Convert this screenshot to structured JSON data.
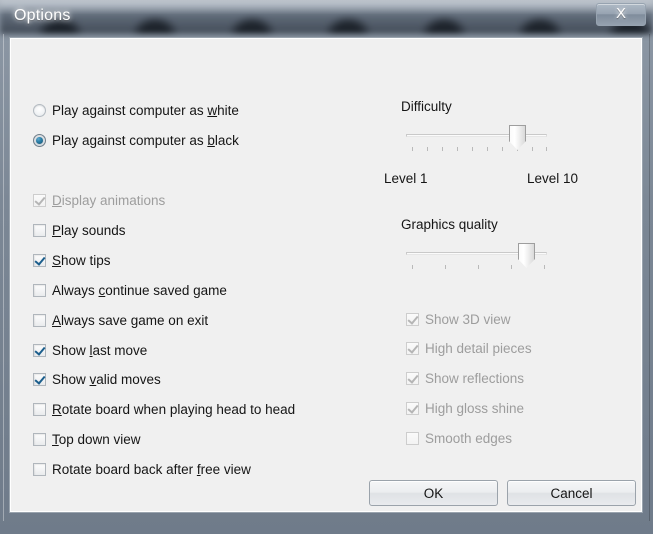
{
  "window": {
    "title": "Options",
    "close_label": "X"
  },
  "play_as": {
    "options": [
      {
        "label_pre": "Play against computer as ",
        "accel": "w",
        "label_post": "hite",
        "checked": false
      },
      {
        "label_pre": "Play against computer as ",
        "accel": "b",
        "label_post": "lack",
        "checked": true
      }
    ]
  },
  "left_checkboxes": [
    {
      "label_pre": "",
      "accel": "D",
      "label_post": "isplay animations",
      "checked": true,
      "disabled": true
    },
    {
      "label_pre": "",
      "accel": "P",
      "label_post": "lay sounds",
      "checked": false,
      "disabled": false
    },
    {
      "label_pre": "",
      "accel": "S",
      "label_post": "how tips",
      "checked": true,
      "disabled": false
    },
    {
      "label_pre": "Always ",
      "accel": "c",
      "label_post": "ontinue saved game",
      "checked": false,
      "disabled": false
    },
    {
      "label_pre": "",
      "accel": "A",
      "label_post": "lways save game on exit",
      "checked": false,
      "disabled": false
    },
    {
      "label_pre": "Show ",
      "accel": "l",
      "label_post": "ast move",
      "checked": true,
      "disabled": false
    },
    {
      "label_pre": "Show ",
      "accel": "v",
      "label_post": "alid moves",
      "checked": true,
      "disabled": false
    },
    {
      "label_pre": "",
      "accel": "R",
      "label_post": "otate board when playing head to head",
      "checked": false,
      "disabled": false
    },
    {
      "label_pre": "",
      "accel": "T",
      "label_post": "op down view",
      "checked": false,
      "disabled": false
    },
    {
      "label_pre": "Rotate board back after ",
      "accel": "f",
      "label_post": "ree view",
      "checked": false,
      "disabled": false
    }
  ],
  "difficulty": {
    "title": "Difficulty",
    "min_label": "Level 1",
    "max_label": "Level 10",
    "ticks": 10,
    "value": 8
  },
  "graphics": {
    "title": "Graphics quality",
    "ticks": 5,
    "value": 4
  },
  "right_checkboxes": [
    {
      "label": "Show 3D view",
      "checked": true,
      "disabled": true
    },
    {
      "label": "High detail pieces",
      "checked": true,
      "disabled": true
    },
    {
      "label": "Show reflections",
      "checked": true,
      "disabled": true
    },
    {
      "label": "High gloss shine",
      "checked": true,
      "disabled": true
    },
    {
      "label": "Smooth edges",
      "checked": false,
      "disabled": true
    }
  ],
  "buttons": {
    "ok": "OK",
    "cancel": "Cancel"
  },
  "colors": {
    "accent_radio": "#2b7fa8",
    "accent_check": "#1b5e8c",
    "client_bg": "#f0f0f0",
    "disabled_text": "#9d9d9d"
  }
}
